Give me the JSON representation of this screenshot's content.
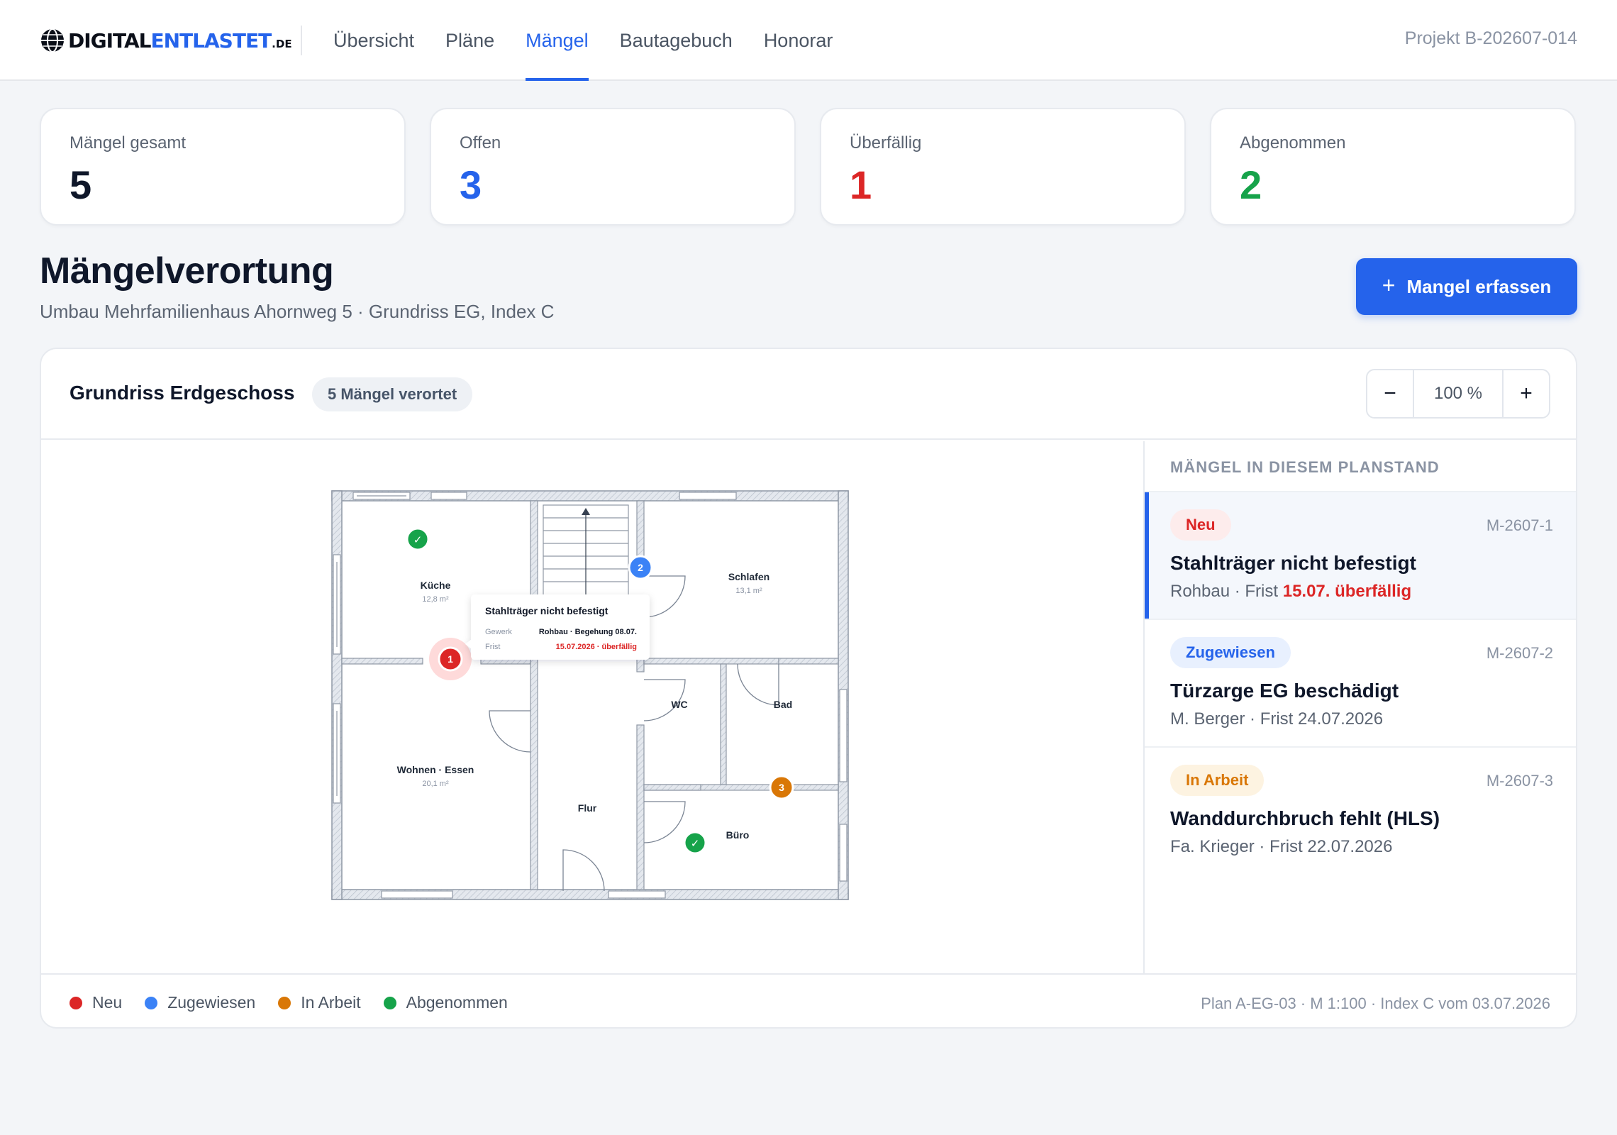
{
  "brand": {
    "part1": "DIGITAL",
    "part2": "ENTLASTET",
    "part3": ".DE"
  },
  "nav": {
    "items": [
      {
        "label": "Übersicht"
      },
      {
        "label": "Pläne"
      },
      {
        "label": "Mängel"
      },
      {
        "label": "Bautagebuch"
      },
      {
        "label": "Honorar"
      }
    ],
    "active": "Mängel"
  },
  "project": {
    "id": "Projekt B-202607-014"
  },
  "stats": [
    {
      "label": "Mängel gesamt",
      "value": "5",
      "color": "#0f172a"
    },
    {
      "label": "Offen",
      "value": "3",
      "color": "#2563eb"
    },
    {
      "label": "Überfällig",
      "value": "1",
      "color": "#dc2626"
    },
    {
      "label": "Abgenommen",
      "value": "2",
      "color": "#16a34a"
    }
  ],
  "page": {
    "title": "Mängelverortung",
    "subtitle": "Umbau Mehrfamilienhaus Ahornweg 5 · Grundriss EG, Index C",
    "add_button": {
      "icon": "+",
      "label": "Mangel erfassen"
    }
  },
  "plan_card": {
    "title": "Grundriss Erdgeschoss",
    "count_pill": "5 Mängel verortet",
    "zoom": {
      "minus": "−",
      "value": "100 %",
      "plus": "+"
    }
  },
  "floorplan": {
    "rooms": [
      {
        "name": "Küche",
        "area": "12,8 m²"
      },
      {
        "name": "Schlafen",
        "area": "13,1 m²"
      },
      {
        "name": "Wohnen · Essen",
        "area": "20,1 m²"
      },
      {
        "name": "WC"
      },
      {
        "name": "Bad"
      },
      {
        "name": "Flur"
      },
      {
        "name": "Büro"
      }
    ],
    "markers": [
      {
        "label": "1",
        "status": "Neu"
      },
      {
        "label": "2",
        "status": "Zugewiesen"
      },
      {
        "label": "3",
        "status": "In Arbeit"
      },
      {
        "label": "✓",
        "status": "Abgenommen"
      },
      {
        "label": "✓",
        "status": "Abgenommen"
      }
    ],
    "tooltip": {
      "title": "Stahlträger nicht befestigt",
      "gewerk_label": "Gewerk",
      "gewerk_value": "Rohbau · Begehung 08.07.",
      "frist_label": "Frist",
      "frist_value": "15.07.2026 · überfällig"
    }
  },
  "defects_panel": {
    "heading": "MÄNGEL IN DIESEM PLANSTAND",
    "items": [
      {
        "status": "Neu",
        "id": "M-2607-1",
        "title": "Stahlträger nicht befestigt",
        "meta": "Rohbau · Frist ",
        "meta_late": "15.07. überfällig",
        "badge_bg": "#fdecec",
        "badge_fg": "#dc2626"
      },
      {
        "status": "Zugewiesen",
        "id": "M-2607-2",
        "title": "Türzarge EG beschädigt",
        "meta": "M. Berger · Frist 24.07.2026",
        "meta_late": "",
        "badge_bg": "#e8f0fe",
        "badge_fg": "#2563eb"
      },
      {
        "status": "In Arbeit",
        "id": "M-2607-3",
        "title": "Wanddurchbruch fehlt (HLS)",
        "meta": "Fa. Krieger · Frist 22.07.2026",
        "meta_late": "",
        "badge_bg": "#fdf3e1",
        "badge_fg": "#d97706"
      }
    ]
  },
  "legend": [
    {
      "label": "Neu",
      "color": "#dc2626"
    },
    {
      "label": "Zugewiesen",
      "color": "#3b82f6"
    },
    {
      "label": "In Arbeit",
      "color": "#d97706"
    },
    {
      "label": "Abgenommen",
      "color": "#16a34a"
    }
  ],
  "plan_meta": "Plan A-EG-03 · M 1:100 · Index C vom 03.07.2026"
}
